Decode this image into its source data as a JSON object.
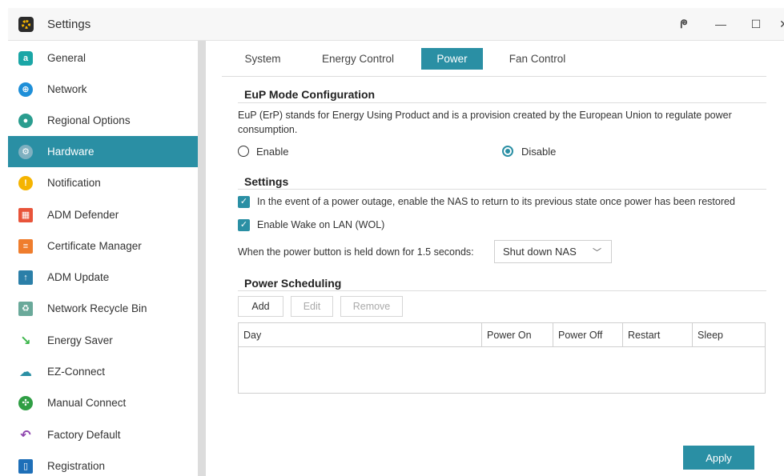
{
  "window": {
    "title": "Settings"
  },
  "sidebar": {
    "items": [
      {
        "label": "General",
        "icon": "general-icon",
        "color": "#1aa6a6"
      },
      {
        "label": "Network",
        "icon": "globe-icon",
        "color": "#1e8fd8"
      },
      {
        "label": "Regional Options",
        "icon": "location-icon",
        "color": "#2a9d8f"
      },
      {
        "label": "Hardware",
        "icon": "hardware-icon",
        "color": "#7fb0c0",
        "active": true
      },
      {
        "label": "Notification",
        "icon": "alert-icon",
        "color": "#f5b400"
      },
      {
        "label": "ADM Defender",
        "icon": "firewall-icon",
        "color": "#e8543a"
      },
      {
        "label": "Certificate Manager",
        "icon": "certificate-icon",
        "color": "#ef7d2d"
      },
      {
        "label": "ADM Update",
        "icon": "update-icon",
        "color": "#2b7fa8"
      },
      {
        "label": "Network Recycle Bin",
        "icon": "recycle-bin-icon",
        "color": "#6aa99a"
      },
      {
        "label": "Energy Saver",
        "icon": "energy-icon",
        "color": "#3bb54a"
      },
      {
        "label": "EZ-Connect",
        "icon": "cloud-upload-icon",
        "color": "#2a8fa4"
      },
      {
        "label": "Manual Connect",
        "icon": "connect-icon",
        "color": "#2f9e44"
      },
      {
        "label": "Factory Default",
        "icon": "undo-icon",
        "color": "#8e44ad"
      },
      {
        "label": "Registration",
        "icon": "registration-icon",
        "color": "#1e6fb8"
      }
    ]
  },
  "tabs": [
    {
      "label": "System"
    },
    {
      "label": "Energy Control"
    },
    {
      "label": "Power",
      "active": true
    },
    {
      "label": "Fan Control"
    }
  ],
  "eup": {
    "title": "EuP Mode Configuration",
    "description": "EuP (ErP) stands for Energy Using Product and is a provision created by the European Union to regulate power consumption.",
    "enable_label": "Enable",
    "disable_label": "Disable",
    "selected": "Disable"
  },
  "settings": {
    "title": "Settings",
    "restore_label": "In the event of a power outage, enable the NAS to return to its previous state once power has been restored",
    "restore_checked": true,
    "wol_label": "Enable Wake on LAN (WOL)",
    "wol_checked": true,
    "power_button_label": "When the power button is held down for 1.5 seconds:",
    "power_button_value": "Shut down NAS"
  },
  "scheduling": {
    "title": "Power Scheduling",
    "add_label": "Add",
    "edit_label": "Edit",
    "remove_label": "Remove",
    "columns": [
      "Day",
      "Power On",
      "Power Off",
      "Restart",
      "Sleep"
    ]
  },
  "footer": {
    "apply_label": "Apply"
  },
  "colors": {
    "accent": "#2a8fa4"
  }
}
